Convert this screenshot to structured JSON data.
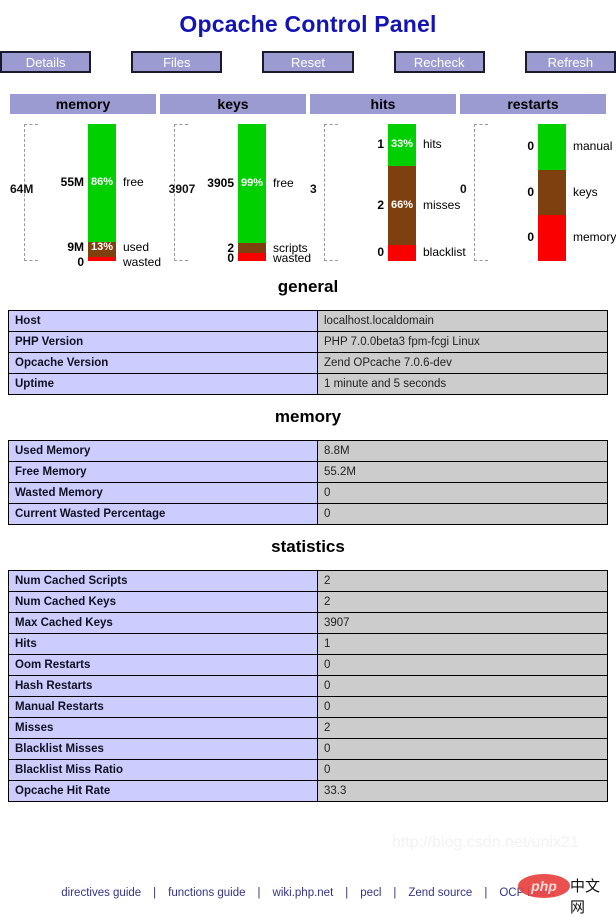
{
  "page": {
    "title": "Opcache Control Panel",
    "title_color": "#1414b4"
  },
  "toolbar": {
    "buttons": [
      {
        "label": "Details",
        "name": "details-button"
      },
      {
        "label": "Files",
        "name": "files-button"
      },
      {
        "label": "Reset",
        "name": "reset-button"
      },
      {
        "label": "Recheck",
        "name": "recheck-button"
      },
      {
        "label": "Refresh",
        "name": "refresh-button"
      }
    ]
  },
  "chart_data": [
    {
      "type": "bar",
      "title": "memory",
      "total_label": "64M",
      "orientation": "vertical-stacked",
      "segments": [
        {
          "label": "free",
          "value": "55M",
          "percent": "86%",
          "pct_num": 86,
          "color": "#00d000",
          "show_pct": true
        },
        {
          "label": "used",
          "value": "9M",
          "percent": "13%",
          "pct_num": 11,
          "color": "#7f4010",
          "show_pct": true
        },
        {
          "label": "wasted",
          "value": "0",
          "percent": "",
          "pct_num": 3,
          "color": "#fa0000",
          "show_pct": false
        }
      ]
    },
    {
      "type": "bar",
      "title": "keys",
      "total_label": "3907",
      "orientation": "vertical-stacked",
      "segments": [
        {
          "label": "free",
          "value": "3905",
          "percent": "99%",
          "pct_num": 87,
          "color": "#00d000",
          "show_pct": true
        },
        {
          "label": "scripts",
          "value": "2",
          "percent": "",
          "pct_num": 7,
          "color": "#7f4010",
          "show_pct": false
        },
        {
          "label": "wasted",
          "value": "0",
          "percent": "",
          "pct_num": 6,
          "color": "#fa0000",
          "show_pct": false
        }
      ]
    },
    {
      "type": "bar",
      "title": "hits",
      "total_label": "3",
      "orientation": "vertical-stacked",
      "segments": [
        {
          "label": "hits",
          "value": "1",
          "percent": "33%",
          "pct_num": 31,
          "color": "#00d000",
          "show_pct": true
        },
        {
          "label": "misses",
          "value": "2",
          "percent": "66%",
          "pct_num": 57,
          "color": "#7f4010",
          "show_pct": true
        },
        {
          "label": "blacklist",
          "value": "0",
          "percent": "",
          "pct_num": 12,
          "color": "#fa0000",
          "show_pct": false
        }
      ]
    },
    {
      "type": "bar",
      "title": "restarts",
      "total_label": "0",
      "orientation": "vertical-stacked",
      "segments": [
        {
          "label": "manual",
          "value": "0",
          "percent": "",
          "pct_num": 33.4,
          "color": "#00d000",
          "show_pct": false
        },
        {
          "label": "keys",
          "value": "0",
          "percent": "",
          "pct_num": 33.3,
          "color": "#7f4010",
          "show_pct": false
        },
        {
          "label": "memory",
          "value": "0",
          "percent": "",
          "pct_num": 33.3,
          "color": "#fa0000",
          "show_pct": false
        }
      ]
    }
  ],
  "sections": [
    {
      "heading": "general",
      "rows": [
        {
          "key": "Host",
          "value": "localhost.localdomain"
        },
        {
          "key": "PHP Version",
          "value": "PHP 7.0.0beta3 fpm-fcgi Linux"
        },
        {
          "key": "Opcache Version",
          "value": "Zend OPcache 7.0.6-dev"
        },
        {
          "key": "Uptime",
          "value": "1 minute and 5 seconds"
        }
      ]
    },
    {
      "heading": "memory",
      "rows": [
        {
          "key": "Used Memory",
          "value": "8.8M"
        },
        {
          "key": "Free Memory",
          "value": "55.2M"
        },
        {
          "key": "Wasted Memory",
          "value": "0"
        },
        {
          "key": "Current Wasted Percentage",
          "value": "0"
        }
      ]
    },
    {
      "heading": "statistics",
      "rows": [
        {
          "key": "Num Cached Scripts",
          "value": "2"
        },
        {
          "key": "Num Cached Keys",
          "value": "2"
        },
        {
          "key": "Max Cached Keys",
          "value": "3907"
        },
        {
          "key": "Hits",
          "value": "1"
        },
        {
          "key": "Oom Restarts",
          "value": "0"
        },
        {
          "key": "Hash Restarts",
          "value": "0"
        },
        {
          "key": "Manual Restarts",
          "value": "0"
        },
        {
          "key": "Misses",
          "value": "2"
        },
        {
          "key": "Blacklist Misses",
          "value": "0"
        },
        {
          "key": "Blacklist Miss Ratio",
          "value": "0"
        },
        {
          "key": "Opcache Hit Rate",
          "value": "33.3"
        }
      ]
    }
  ],
  "footer": {
    "links": [
      {
        "label": "directives guide"
      },
      {
        "label": "functions guide"
      },
      {
        "label": "wiki.php.net"
      },
      {
        "label": "pecl"
      },
      {
        "label": "Zend source"
      },
      {
        "label": "OCP latest"
      }
    ],
    "separator": "|"
  },
  "watermarks": {
    "middle": "http://blog.csdn.net/",
    "lower": "http://blog.csdn.net/unix21",
    "logo_text": "php",
    "logo_cn": "中文网"
  }
}
